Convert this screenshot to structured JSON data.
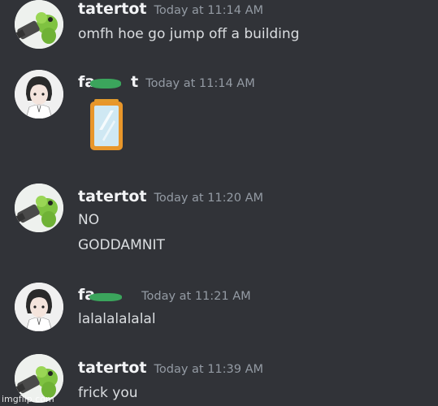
{
  "messages": [
    {
      "username": "tatertot",
      "timestamp": "Today at 11:14 AM",
      "lines": [
        "omfh hoe go jump off a building"
      ],
      "avatar_icon": "green-caterpillar-avatar"
    },
    {
      "username": "fa",
      "username_tail": "t",
      "timestamp": "Today at 11:14 AM",
      "lines": [],
      "attachment_icon": "mirror-emoji",
      "avatar_icon": "anime-boy-avatar"
    },
    {
      "username": "tatertot",
      "timestamp": "Today at 11:20 AM",
      "lines": [
        "NO",
        "GODDAMNIT"
      ],
      "avatar_icon": "green-caterpillar-avatar"
    },
    {
      "username": "fa",
      "username_tail": "",
      "timestamp": "Today at 11:21 AM",
      "lines": [
        "lalalalalalal"
      ],
      "avatar_icon": "anime-boy-avatar"
    },
    {
      "username": "tatertot",
      "timestamp": "Today at 11:39 AM",
      "lines": [
        "frick you"
      ],
      "avatar_icon": "green-caterpillar-avatar"
    }
  ],
  "watermark": "imgflip.com",
  "colors": {
    "background": "#313338",
    "username": "#f2f3f5",
    "timestamp": "#949ba4",
    "text": "#dbdee1",
    "censor": "#3ba55c"
  }
}
